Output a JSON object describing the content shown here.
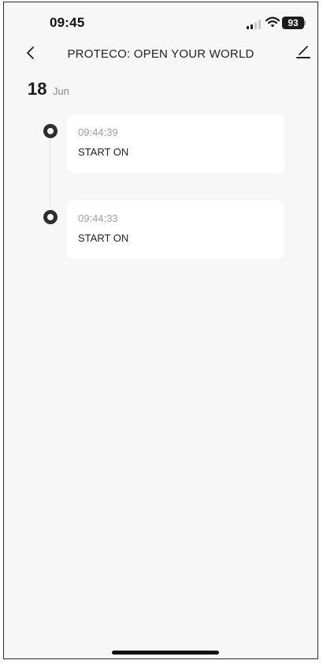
{
  "status_bar": {
    "time": "09:45",
    "battery": "93",
    "icons": [
      "signal-icon",
      "wifi-icon",
      "battery-icon"
    ]
  },
  "nav": {
    "title": "PROTECO: OPEN YOUR WORLD",
    "back_icon": "chevron-left-icon",
    "edit_icon": "pencil-icon"
  },
  "date_header": {
    "day": "18",
    "month": "Jun"
  },
  "events": [
    {
      "time": "09:44:39",
      "label": "START ON"
    },
    {
      "time": "09:44:33",
      "label": "START ON"
    }
  ],
  "colors": {
    "background": "#f7f7f7",
    "card": "#ffffff",
    "dot": "#2f2f2f",
    "muted_text": "#a0a0a0"
  }
}
